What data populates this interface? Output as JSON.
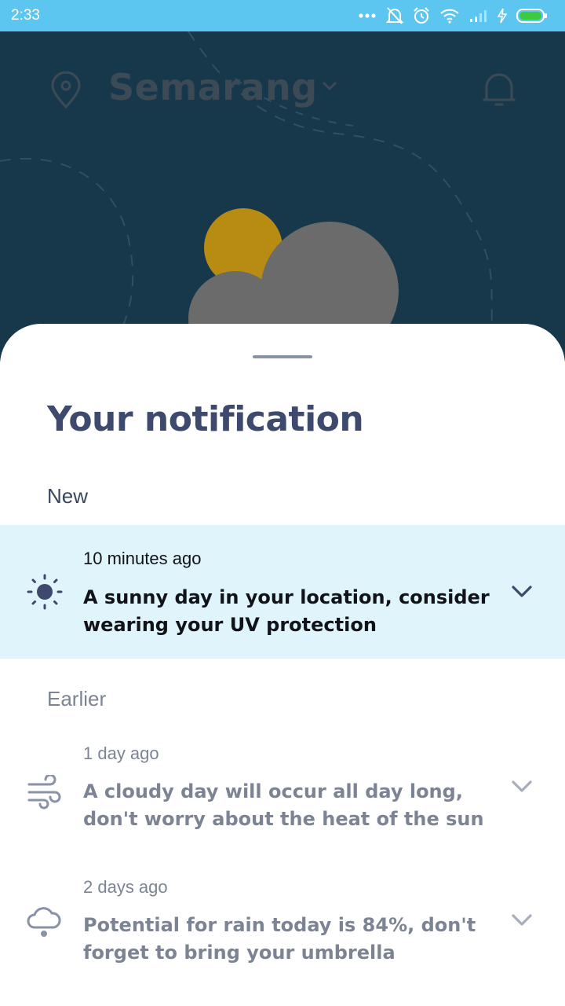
{
  "status_bar": {
    "time": "2:33",
    "icons": [
      "more-dots-icon",
      "bell-muted-icon",
      "alarm-icon",
      "wifi-icon",
      "signal-icon",
      "charging-icon",
      "battery-icon"
    ],
    "battery_color": "#3ec93e"
  },
  "background": {
    "city": "Semarang",
    "color": "#17384b",
    "icons": [
      "location-pin-icon",
      "chevron-down-icon",
      "bell-icon",
      "sun-cloud-weather-icon"
    ]
  },
  "sheet": {
    "title": "Your notification",
    "sections": {
      "new": "New",
      "earlier": "Earlier"
    },
    "notifications": [
      {
        "time": "10 minutes ago",
        "message": "A sunny day in your location, consider wearing your UV protection",
        "icon": "sun-icon",
        "unread": true,
        "highlight_color": "#dff4fb"
      },
      {
        "time": "1 day ago",
        "message": "A cloudy day will occur all day long, don't worry about the heat of the sun",
        "icon": "wind-icon",
        "unread": false
      },
      {
        "time": "2 days ago",
        "message": "Potential for rain today is 84%, don't forget to bring your umbrella",
        "icon": "rain-cloud-icon",
        "unread": false
      }
    ]
  }
}
